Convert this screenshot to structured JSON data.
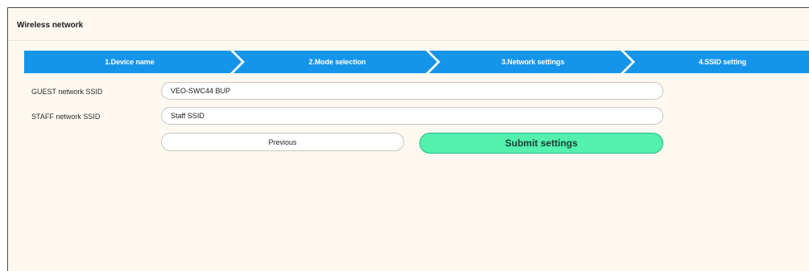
{
  "header": {
    "title": "Wireless network"
  },
  "steps": [
    {
      "label": "1.Device name"
    },
    {
      "label": "2.Mode selection"
    },
    {
      "label": "3.Network settings"
    },
    {
      "label": "4.SSID setting"
    }
  ],
  "form": {
    "guest_ssid": {
      "label": "GUEST network SSID",
      "value": "VEO-SWC44 BUP"
    },
    "staff_ssid": {
      "label": "STAFF network SSID",
      "value": "Staff SSID"
    }
  },
  "actions": {
    "previous_label": "Previous",
    "submit_label": "Submit settings"
  },
  "colors": {
    "step_blue": "#1495ea",
    "submit_green": "#54f0ae",
    "panel_background": "#fdf9f1"
  }
}
